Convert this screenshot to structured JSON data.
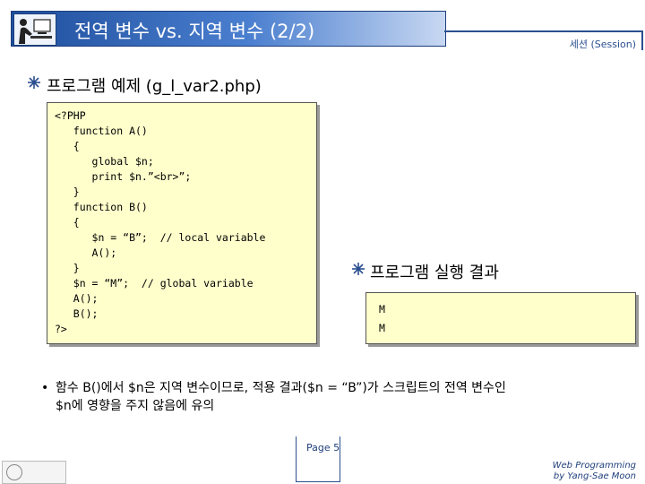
{
  "header": {
    "title": "전역 변수 vs. 지역 변수 (2/2)",
    "session_label": "세션 (Session)"
  },
  "section1": {
    "heading": "프로그램 예제 (g_l_var2.php)"
  },
  "code_lines": [
    "<?PHP",
    "   function A()",
    "   {",
    "      global $n;",
    "      print $n.”<br>”;",
    "   }",
    "   function B()",
    "   {",
    "      $n = “B”;  // local variable",
    "      A();",
    "   }",
    "   $n = “M”;  // global variable",
    "   A();",
    "   B();",
    "?>"
  ],
  "section2": {
    "heading": "프로그램 실행 결과"
  },
  "result_lines": [
    "M",
    "M"
  ],
  "note": {
    "bullet": "•",
    "line1": "함수 B()에서 $n은 지역 변수이므로, 적용 결과($n = “B”)가 스크립트의 전역 변수인",
    "line2": "$n에 영향을 주지 않음에 유의"
  },
  "footer": {
    "logo_text": "",
    "page": "Page 5",
    "credit_line1": "Web Programming",
    "credit_line2": "by Yang-Sae Moon"
  },
  "colors": {
    "title_bg": "#2b5aa8",
    "code_bg": "#ffffcc",
    "footer_text": "#1f3f7a"
  }
}
